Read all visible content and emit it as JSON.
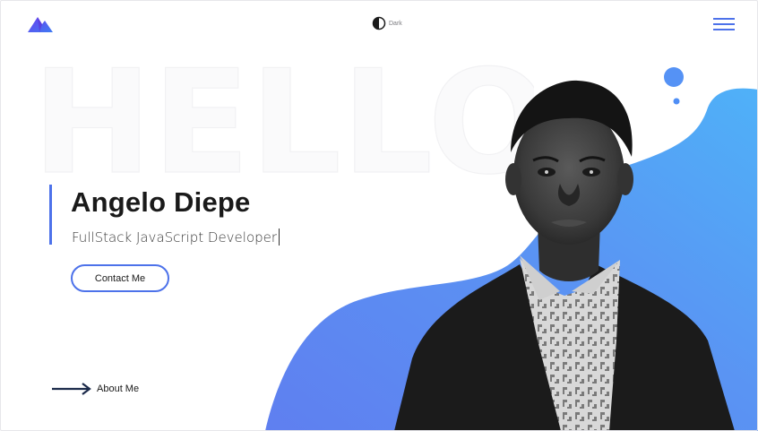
{
  "header": {
    "logo_icon": "mountain-logo-icon",
    "theme_toggle": {
      "icon": "half-moon-icon",
      "label": "Dark"
    },
    "menu_icon": "hamburger-menu-icon"
  },
  "hero": {
    "backdrop_text": "HELLO",
    "name": "Angelo Diepe",
    "role": "FullStack JavaScript Developer",
    "contact_button": "Contact Me",
    "about_link": "About Me"
  },
  "colors": {
    "accent": "#4d72ea",
    "blob_light": "#58a8f7",
    "blob_dark": "#5b82f0",
    "text": "#1a1a1a"
  }
}
